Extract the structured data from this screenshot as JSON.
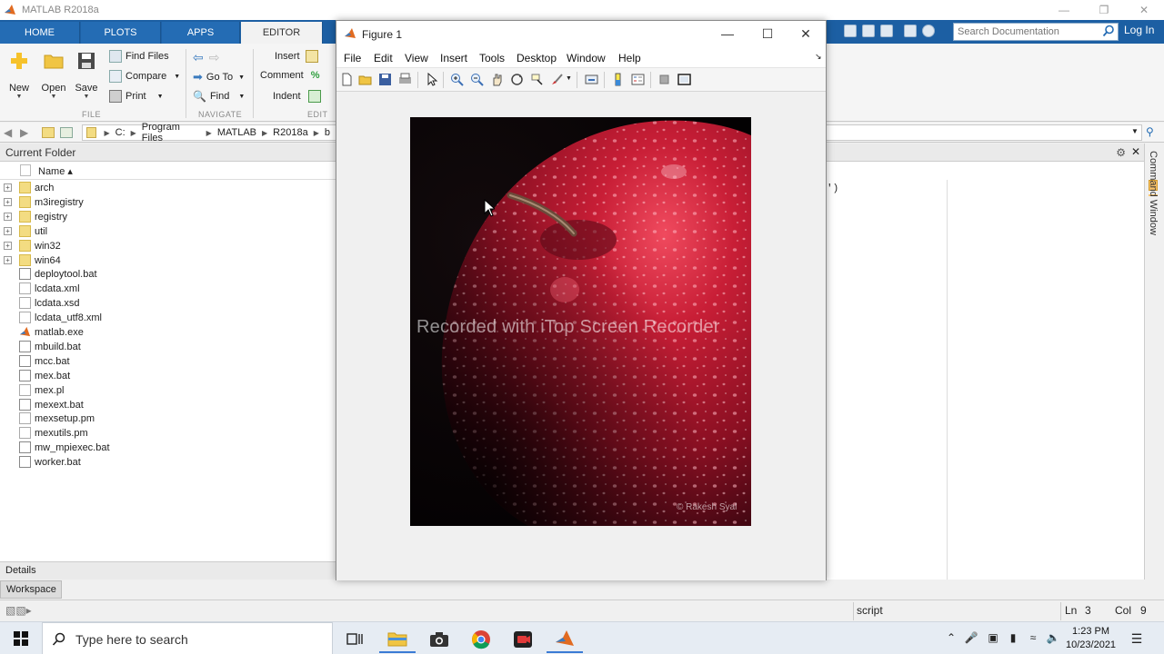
{
  "matlab": {
    "title": "MATLAB R2018a",
    "tabs": [
      "HOME",
      "PLOTS",
      "APPS",
      "EDITOR"
    ],
    "search_placeholder": "Search Documentation",
    "login_label": "Log In",
    "ribbon": {
      "file": {
        "new": "New",
        "open": "Open",
        "save": "Save",
        "find_files": "Find Files",
        "compare": "Compare",
        "print": "Print",
        "section": "FILE"
      },
      "navigate": {
        "go_to": "Go To",
        "find": "Find",
        "section": "NAVIGATE"
      },
      "edit": {
        "insert": "Insert",
        "comment": "Comment",
        "indent": "Indent",
        "section": "EDIT"
      }
    },
    "path": [
      "C:",
      "Program Files",
      "MATLAB",
      "R2018a",
      "b"
    ],
    "current_folder": {
      "title": "Current Folder",
      "name_header": "Name ▴",
      "items": [
        {
          "label": "arch",
          "kind": "folder"
        },
        {
          "label": "m3iregistry",
          "kind": "folder"
        },
        {
          "label": "registry",
          "kind": "folder"
        },
        {
          "label": "util",
          "kind": "folder"
        },
        {
          "label": "win32",
          "kind": "folder"
        },
        {
          "label": "win64",
          "kind": "folder"
        },
        {
          "label": "deploytool.bat",
          "kind": "bat"
        },
        {
          "label": "lcdata.xml",
          "kind": "file"
        },
        {
          "label": "lcdata.xsd",
          "kind": "file"
        },
        {
          "label": "lcdata_utf8.xml",
          "kind": "file"
        },
        {
          "label": "matlab.exe",
          "kind": "exe"
        },
        {
          "label": "mbuild.bat",
          "kind": "bat"
        },
        {
          "label": "mcc.bat",
          "kind": "bat"
        },
        {
          "label": "mex.bat",
          "kind": "bat"
        },
        {
          "label": "mex.pl",
          "kind": "file"
        },
        {
          "label": "mexext.bat",
          "kind": "bat"
        },
        {
          "label": "mexsetup.pm",
          "kind": "file"
        },
        {
          "label": "mexutils.pm",
          "kind": "file"
        },
        {
          "label": "mw_mpiexec.bat",
          "kind": "bat"
        },
        {
          "label": "worker.bat",
          "kind": "bat"
        }
      ]
    },
    "details_label": "Details",
    "workspace_label": "Workspace",
    "editor_code_fragment": "')",
    "command_window_label": "Command Window",
    "status": {
      "mode": "script",
      "ln_label": "Ln",
      "ln": "3",
      "col_label": "Col",
      "col": "9"
    }
  },
  "figure": {
    "title": "Figure 1",
    "menu": [
      "File",
      "Edit",
      "View",
      "Insert",
      "Tools",
      "Desktop",
      "Window",
      "Help"
    ],
    "watermark": "Recorded with iTop Screen Recorder",
    "copyright": "© Rakesh Syal"
  },
  "taskbar": {
    "search_placeholder": "Type here to search",
    "time": "1:23 PM",
    "date": "10/23/2021"
  },
  "colors": {
    "matlab_blue": "#1c5fa3",
    "apple_red": "#b3122a"
  }
}
